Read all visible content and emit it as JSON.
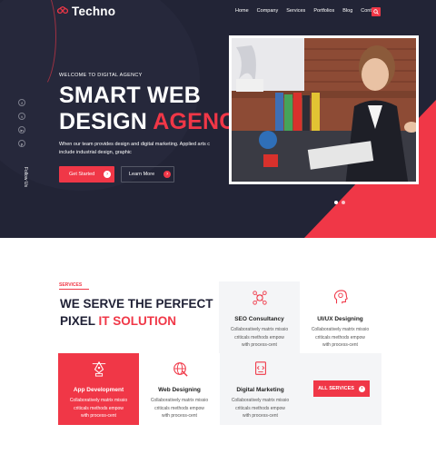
{
  "brand": {
    "name": "Techno"
  },
  "nav": {
    "items": [
      "Home",
      "Company",
      "Services",
      "Portfolios",
      "Blog",
      "Contact"
    ]
  },
  "hero": {
    "eyebrow": "WELCOME TO DIGITAL AGENCY",
    "title_line1": "SMART WEB",
    "title_line2_plain": "DESIGN ",
    "title_line2_accent": "AGENCY",
    "lead_line1": "When our team provides design and digital marketing. Applied arts c",
    "lead_line2": "include industrial design, graphic",
    "primary_button": "Get Started",
    "secondary_button": "Learn More",
    "follow_label": "Follow Us",
    "social": [
      "f",
      "t",
      "in",
      "y"
    ],
    "slider": {
      "count": 2,
      "active": 1
    }
  },
  "services": {
    "tag": "SERVICES",
    "title_line1": "WE SERVE THE PERFECT",
    "title_line2_plain": "PIXEL ",
    "title_line2_accent": "IT SOLUTION",
    "cards": [
      {
        "title": "SEO Consultancy",
        "desc": [
          "Collaboratively matrix missio",
          "criticals methods empow",
          "with process-cent"
        ]
      },
      {
        "title": "UI/UX Designing",
        "desc": [
          "Collaboratively matrix missio",
          "criticals methods empow",
          "with process-cent"
        ]
      },
      {
        "title": "App Development",
        "desc": [
          "Collaboratively matrix missio",
          "criticals methods empow",
          "with process-cent"
        ]
      },
      {
        "title": "Web Designing",
        "desc": [
          "Collaboratively matrix missio",
          "criticals methods empow",
          "with process-cent"
        ]
      },
      {
        "title": "Digital Marketing",
        "desc": [
          "Collaboratively matrix missio",
          "criticals methods empow",
          "with process-cent"
        ]
      }
    ],
    "all_button": "ALL SERVICES"
  },
  "colors": {
    "accent": "#f03747",
    "dark": "#222436"
  }
}
